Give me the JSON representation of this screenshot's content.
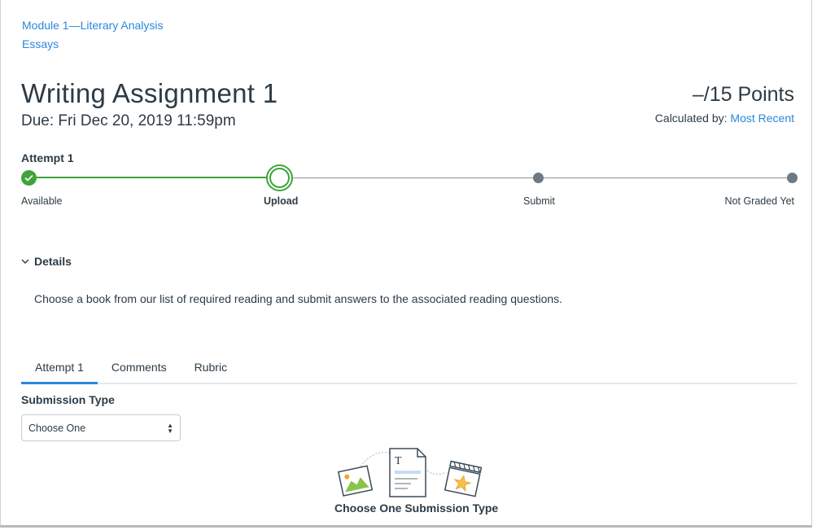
{
  "breadcrumbs": [
    "Module 1—Literary Analysis",
    "Essays"
  ],
  "assignment": {
    "title": "Writing Assignment 1",
    "due": "Due: Fri Dec 20, 2019 11:59pm",
    "points": "–/15 Points",
    "calculated_by_label": "Calculated by:",
    "calculated_by_value": "Most Recent"
  },
  "progress": {
    "attempt_label": "Attempt 1",
    "steps": [
      {
        "label": "Available",
        "state": "complete"
      },
      {
        "label": "Upload",
        "state": "current"
      },
      {
        "label": "Submit",
        "state": "pending"
      },
      {
        "label": "Not Graded Yet",
        "state": "pending"
      }
    ],
    "colors": {
      "complete": "#3FA33A",
      "pending": "#6C7A86"
    }
  },
  "details": {
    "toggle_label": "Details",
    "expanded": true,
    "text": "Choose a book from our list of required reading and submit answers to the associated reading questions."
  },
  "tabs": [
    {
      "label": "Attempt 1",
      "active": true
    },
    {
      "label": "Comments",
      "active": false
    },
    {
      "label": "Rubric",
      "active": false
    }
  ],
  "submission": {
    "type_label": "Submission Type",
    "selected_option": "Choose One",
    "empty_state_caption": "Choose One Submission Type",
    "icons": [
      "image-icon",
      "text-document-icon",
      "media-clapper-icon"
    ]
  },
  "colors": {
    "link": "#2B88D8",
    "text": "#2D3B45",
    "tab_active": "#2B88D8"
  }
}
